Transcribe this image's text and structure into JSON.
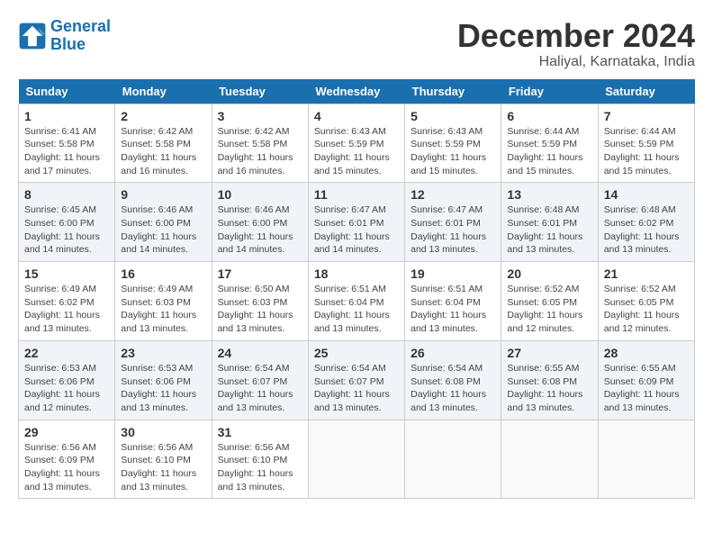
{
  "logo": {
    "line1": "General",
    "line2": "Blue"
  },
  "title": "December 2024",
  "subtitle": "Haliyal, Karnataka, India",
  "weekdays": [
    "Sunday",
    "Monday",
    "Tuesday",
    "Wednesday",
    "Thursday",
    "Friday",
    "Saturday"
  ],
  "weeks": [
    [
      {
        "day": 1,
        "info": "Sunrise: 6:41 AM\nSunset: 5:58 PM\nDaylight: 11 hours\nand 17 minutes."
      },
      {
        "day": 2,
        "info": "Sunrise: 6:42 AM\nSunset: 5:58 PM\nDaylight: 11 hours\nand 16 minutes."
      },
      {
        "day": 3,
        "info": "Sunrise: 6:42 AM\nSunset: 5:58 PM\nDaylight: 11 hours\nand 16 minutes."
      },
      {
        "day": 4,
        "info": "Sunrise: 6:43 AM\nSunset: 5:59 PM\nDaylight: 11 hours\nand 15 minutes."
      },
      {
        "day": 5,
        "info": "Sunrise: 6:43 AM\nSunset: 5:59 PM\nDaylight: 11 hours\nand 15 minutes."
      },
      {
        "day": 6,
        "info": "Sunrise: 6:44 AM\nSunset: 5:59 PM\nDaylight: 11 hours\nand 15 minutes."
      },
      {
        "day": 7,
        "info": "Sunrise: 6:44 AM\nSunset: 5:59 PM\nDaylight: 11 hours\nand 15 minutes."
      }
    ],
    [
      {
        "day": 8,
        "info": "Sunrise: 6:45 AM\nSunset: 6:00 PM\nDaylight: 11 hours\nand 14 minutes."
      },
      {
        "day": 9,
        "info": "Sunrise: 6:46 AM\nSunset: 6:00 PM\nDaylight: 11 hours\nand 14 minutes."
      },
      {
        "day": 10,
        "info": "Sunrise: 6:46 AM\nSunset: 6:00 PM\nDaylight: 11 hours\nand 14 minutes."
      },
      {
        "day": 11,
        "info": "Sunrise: 6:47 AM\nSunset: 6:01 PM\nDaylight: 11 hours\nand 14 minutes."
      },
      {
        "day": 12,
        "info": "Sunrise: 6:47 AM\nSunset: 6:01 PM\nDaylight: 11 hours\nand 13 minutes."
      },
      {
        "day": 13,
        "info": "Sunrise: 6:48 AM\nSunset: 6:01 PM\nDaylight: 11 hours\nand 13 minutes."
      },
      {
        "day": 14,
        "info": "Sunrise: 6:48 AM\nSunset: 6:02 PM\nDaylight: 11 hours\nand 13 minutes."
      }
    ],
    [
      {
        "day": 15,
        "info": "Sunrise: 6:49 AM\nSunset: 6:02 PM\nDaylight: 11 hours\nand 13 minutes."
      },
      {
        "day": 16,
        "info": "Sunrise: 6:49 AM\nSunset: 6:03 PM\nDaylight: 11 hours\nand 13 minutes."
      },
      {
        "day": 17,
        "info": "Sunrise: 6:50 AM\nSunset: 6:03 PM\nDaylight: 11 hours\nand 13 minutes."
      },
      {
        "day": 18,
        "info": "Sunrise: 6:51 AM\nSunset: 6:04 PM\nDaylight: 11 hours\nand 13 minutes."
      },
      {
        "day": 19,
        "info": "Sunrise: 6:51 AM\nSunset: 6:04 PM\nDaylight: 11 hours\nand 13 minutes."
      },
      {
        "day": 20,
        "info": "Sunrise: 6:52 AM\nSunset: 6:05 PM\nDaylight: 11 hours\nand 12 minutes."
      },
      {
        "day": 21,
        "info": "Sunrise: 6:52 AM\nSunset: 6:05 PM\nDaylight: 11 hours\nand 12 minutes."
      }
    ],
    [
      {
        "day": 22,
        "info": "Sunrise: 6:53 AM\nSunset: 6:06 PM\nDaylight: 11 hours\nand 12 minutes."
      },
      {
        "day": 23,
        "info": "Sunrise: 6:53 AM\nSunset: 6:06 PM\nDaylight: 11 hours\nand 13 minutes."
      },
      {
        "day": 24,
        "info": "Sunrise: 6:54 AM\nSunset: 6:07 PM\nDaylight: 11 hours\nand 13 minutes."
      },
      {
        "day": 25,
        "info": "Sunrise: 6:54 AM\nSunset: 6:07 PM\nDaylight: 11 hours\nand 13 minutes."
      },
      {
        "day": 26,
        "info": "Sunrise: 6:54 AM\nSunset: 6:08 PM\nDaylight: 11 hours\nand 13 minutes."
      },
      {
        "day": 27,
        "info": "Sunrise: 6:55 AM\nSunset: 6:08 PM\nDaylight: 11 hours\nand 13 minutes."
      },
      {
        "day": 28,
        "info": "Sunrise: 6:55 AM\nSunset: 6:09 PM\nDaylight: 11 hours\nand 13 minutes."
      }
    ],
    [
      {
        "day": 29,
        "info": "Sunrise: 6:56 AM\nSunset: 6:09 PM\nDaylight: 11 hours\nand 13 minutes."
      },
      {
        "day": 30,
        "info": "Sunrise: 6:56 AM\nSunset: 6:10 PM\nDaylight: 11 hours\nand 13 minutes."
      },
      {
        "day": 31,
        "info": "Sunrise: 6:56 AM\nSunset: 6:10 PM\nDaylight: 11 hours\nand 13 minutes."
      },
      null,
      null,
      null,
      null
    ]
  ]
}
